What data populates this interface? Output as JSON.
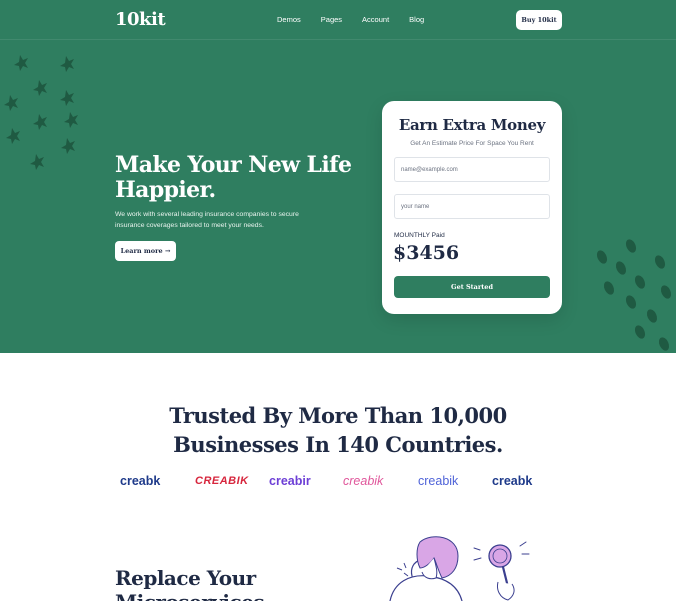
{
  "nav": {
    "logo": "10kit",
    "links": [
      "Demos",
      "Pages",
      "Account",
      "Blog"
    ],
    "buy_label": "Buy 10kit"
  },
  "hero": {
    "title": "Make Your New Life Happier.",
    "subtitle": "We work with several leading insurance companies to secure insurance coverages tailored to meet your needs.",
    "learn_more": "Learn more →"
  },
  "card": {
    "title": "Earn Extra Money",
    "subtitle": "Get An Estimate Price For Space You Rent",
    "email_placeholder": "name@example.com",
    "name_placeholder": "your name",
    "paid_label": "MOUNTHLY Paid",
    "price": "$3456",
    "cta": "Get Started"
  },
  "trusted": {
    "line1": "Trusted By More Than 10,000",
    "line2": "Businesses In 140 Countries."
  },
  "brands": [
    "creabk",
    "CREABIK",
    "creabir",
    "creabik",
    "creabik",
    "creabk"
  ],
  "section2": {
    "title": "Replace Your Microservices"
  },
  "colors": {
    "hero_bg": "#2f7e60",
    "decor": "#1f5a42",
    "dark_text": "#1f2a44"
  }
}
